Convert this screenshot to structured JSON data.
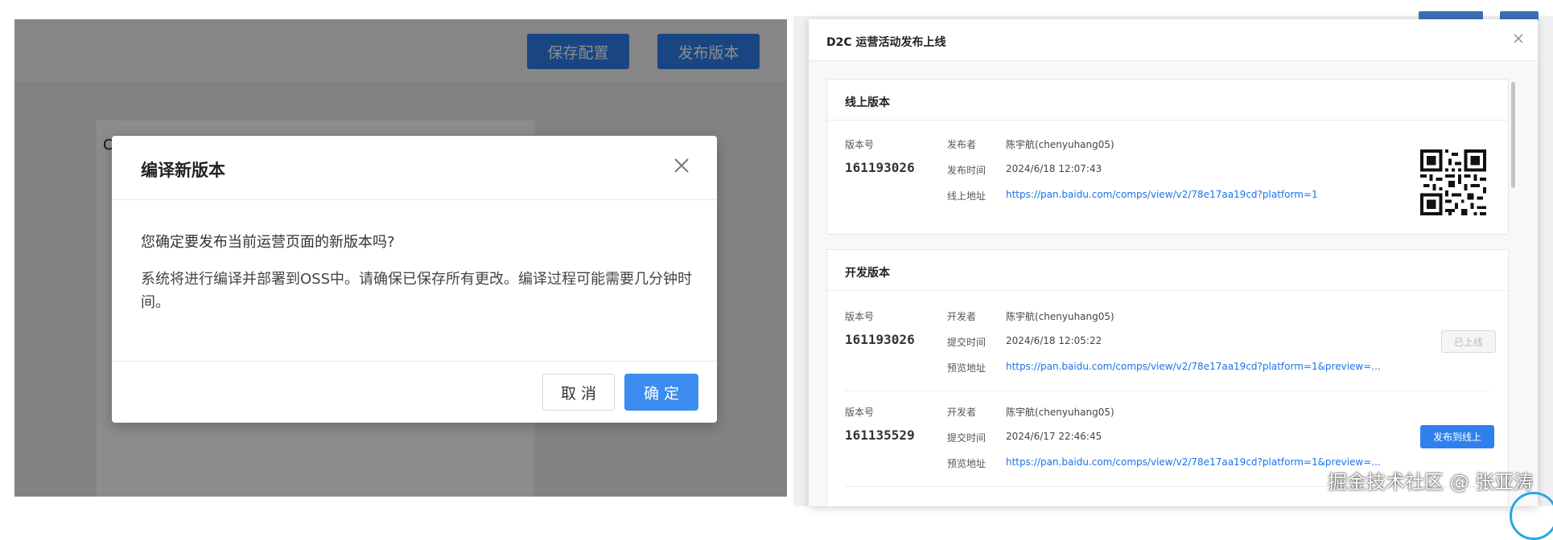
{
  "left": {
    "toolbar": {
      "save_config_label": "保存配置",
      "publish_label": "发布版本"
    },
    "canvas_stub": "C",
    "dialog": {
      "title": "编译新版本",
      "question": "您确定要发布当前运营页面的新版本吗?",
      "description": "系统将进行编译并部署到OSS中。请确保已保存所有更改。编译过程可能需要几分钟时间。",
      "cancel_label": "取 消",
      "ok_label": "确 定",
      "close_icon": "close-icon"
    }
  },
  "right": {
    "modal_title": "D2C 运营活动发布上线",
    "close_icon": "close-icon",
    "online": {
      "section_title": "线上版本",
      "version_label": "版本号",
      "version": "161193026",
      "publisher_label": "发布者",
      "publisher": "陈宇航(chenyuhang05)",
      "publish_time_label": "发布时间",
      "publish_time": "2024/6/18 12:07:43",
      "url_label": "线上地址",
      "url": "https://pan.baidu.com/comps/view/v2/78e17aa19cd?platform=1",
      "qr_icon": "qr-code-icon"
    },
    "dev": {
      "section_title": "开发版本",
      "rows": [
        {
          "version_label": "版本号",
          "version": "161193026",
          "developer_label": "开发者",
          "developer": "陈宇航(chenyuhang05)",
          "submit_time_label": "提交时间",
          "submit_time": "2024/6/18 12:05:22",
          "preview_label": "预览地址",
          "preview_url": "https://pan.baidu.com/comps/view/v2/78e17aa19cd?platform=1&preview=...",
          "action_label": "已上线",
          "action_state": "disabled"
        },
        {
          "version_label": "版本号",
          "version": "161135529",
          "developer_label": "开发者",
          "developer": "陈宇航(chenyuhang05)",
          "submit_time_label": "提交时间",
          "submit_time": "2024/6/17 22:46:45",
          "preview_label": "预览地址",
          "preview_url": "https://pan.baidu.com/comps/view/v2/78e17aa19cd?platform=1&preview=...",
          "action_label": "发布到线上",
          "action_state": "enabled"
        }
      ]
    }
  },
  "credit": "掘金技术社区 @ 张亚涛",
  "colors": {
    "primary": "#2f80ed",
    "link": "#1a73e8",
    "mask": "rgba(0,0,0,0.45)"
  }
}
